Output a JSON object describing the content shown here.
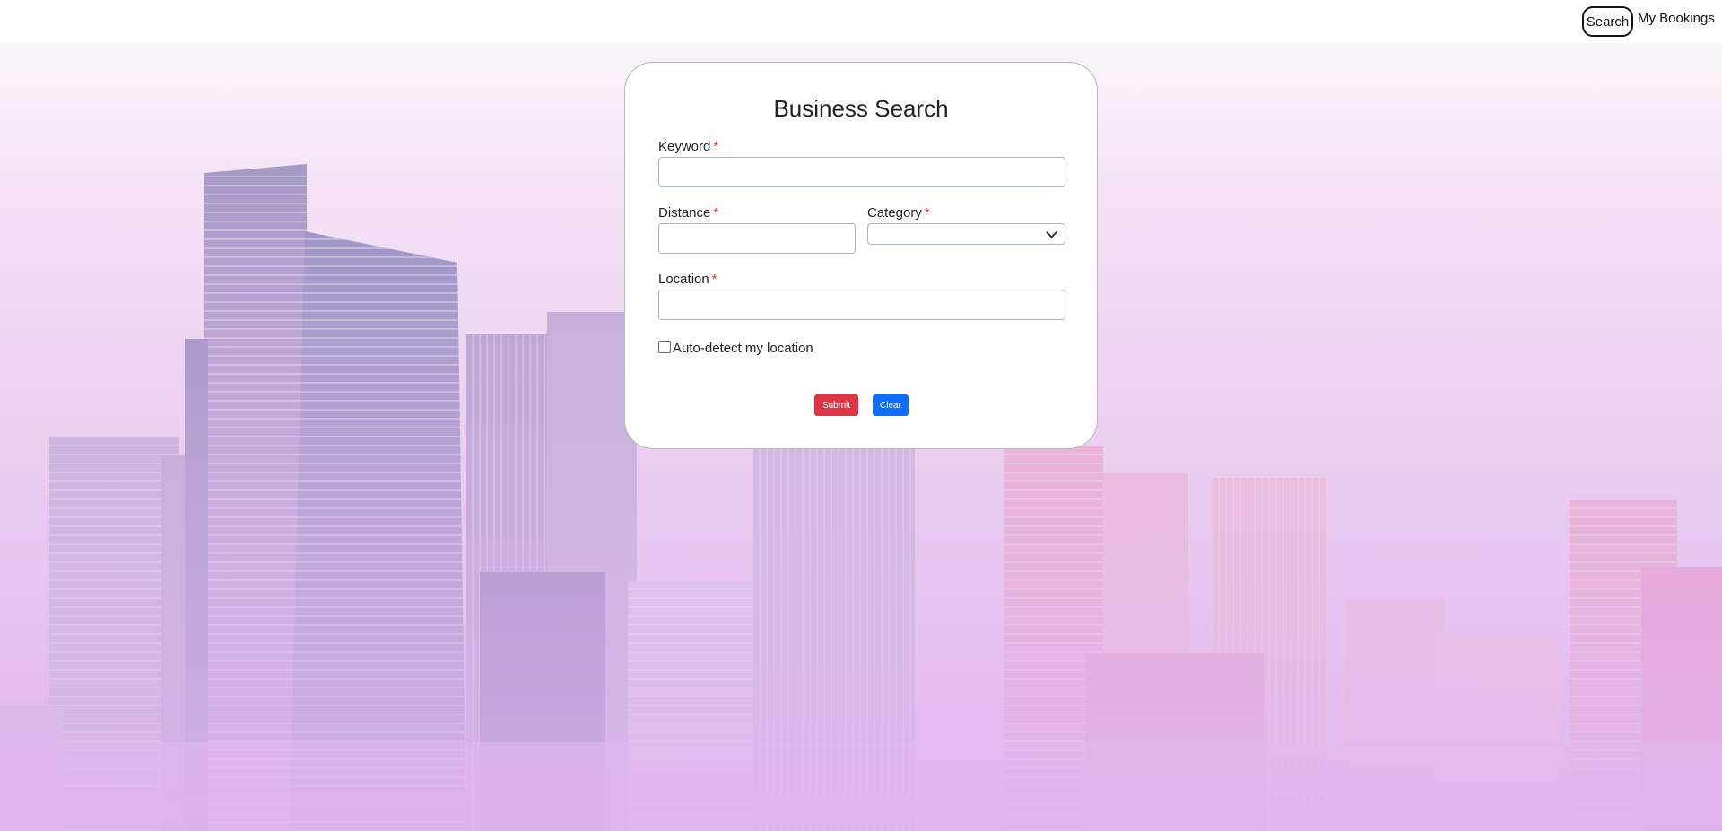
{
  "nav": {
    "search_label": "Search",
    "bookings_label": "My Bookings"
  },
  "form": {
    "title": "Business Search",
    "keyword": {
      "label": "Keyword",
      "required_mark": "*",
      "value": ""
    },
    "distance": {
      "label": "Distance",
      "required_mark": "*",
      "value": ""
    },
    "category": {
      "label": "Category",
      "required_mark": "*",
      "selected": ""
    },
    "location": {
      "label": "Location",
      "required_mark": "*",
      "value": ""
    },
    "auto_detect": {
      "label": "Auto-detect my location",
      "checked": false
    },
    "submit_label": "Submit",
    "clear_label": "Clear"
  },
  "colors": {
    "submit": "#dc3545",
    "clear": "#0d6efd",
    "required": "#dc3545",
    "background_tint": "#e8c9ee"
  }
}
